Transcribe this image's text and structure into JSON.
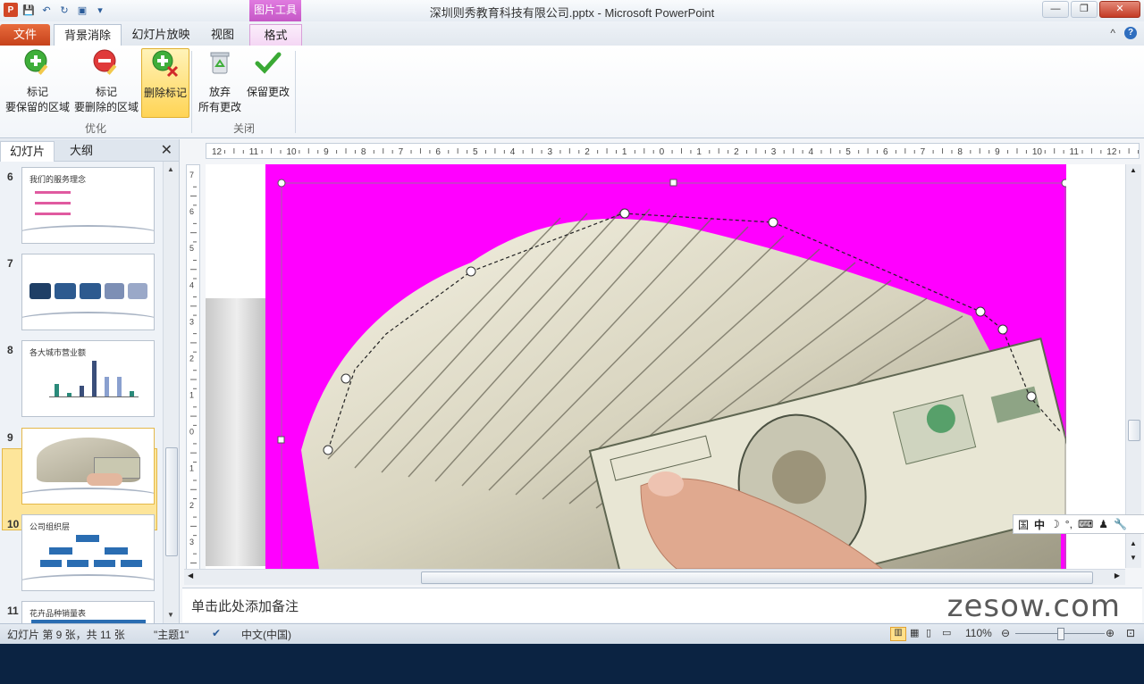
{
  "window": {
    "title": "深圳则秀教育科技有限公司.pptx - Microsoft PowerPoint",
    "context_tab": "图片工具",
    "controls": {
      "minimize": "—",
      "restore": "❐",
      "close": "✕"
    }
  },
  "quick_access": {
    "logo": "P",
    "save": "💾",
    "undo": "↶",
    "redo": "↻",
    "layout": "▣",
    "more": "▾"
  },
  "tabs": {
    "file": "文件",
    "bg_remove": "背景消除",
    "slideshow": "幻灯片放映",
    "view": "视图",
    "format": "格式",
    "collapse": "^",
    "help": "?"
  },
  "ribbon": {
    "mark_keep": [
      "标记",
      "要保留的区域"
    ],
    "mark_remove": [
      "标记",
      "要删除的区域"
    ],
    "delete_mark": "删除标记",
    "discard": [
      "放弃",
      "所有更改"
    ],
    "keep_changes": "保留更改",
    "group_refine": "优化",
    "group_close": "关闭"
  },
  "left_pane": {
    "tab_slides": "幻灯片",
    "tab_outline": "大纲",
    "close": "✕",
    "slides": [
      {
        "num": "6",
        "title": "我们的服务理念"
      },
      {
        "num": "7",
        "title": ""
      },
      {
        "num": "8",
        "title": "各大城市营业额"
      },
      {
        "num": "9",
        "title": ""
      },
      {
        "num": "10",
        "title": "公司组织层"
      },
      {
        "num": "11",
        "title": "花卉品种销量表"
      }
    ]
  },
  "ruler": {
    "h_labels": [
      "12",
      "11",
      "10",
      "9",
      "8",
      "7",
      "6",
      "5",
      "4",
      "3",
      "2",
      "1",
      "0",
      "1",
      "2",
      "3",
      "4",
      "5",
      "6",
      "7",
      "8",
      "9",
      "10",
      "11",
      "12"
    ],
    "v_labels": [
      "7",
      "6",
      "5",
      "4",
      "3",
      "2",
      "1",
      "0",
      "1",
      "2",
      "3"
    ]
  },
  "notes": {
    "placeholder": "单击此处添加备注"
  },
  "watermark": "zesow.com",
  "ime": {
    "items": [
      "国",
      "中",
      "☽",
      "°,",
      "⌨",
      "♟",
      "🔧"
    ]
  },
  "status": {
    "slide_info": "幻灯片 第 9 张，共 11 张",
    "theme": "\"主题1\"",
    "language": "中文(中国)",
    "zoom": "110%"
  },
  "colors": {
    "remove_overlay": "#ff00ff",
    "accent": "#d24726",
    "picture_tools": "#c557c6"
  }
}
